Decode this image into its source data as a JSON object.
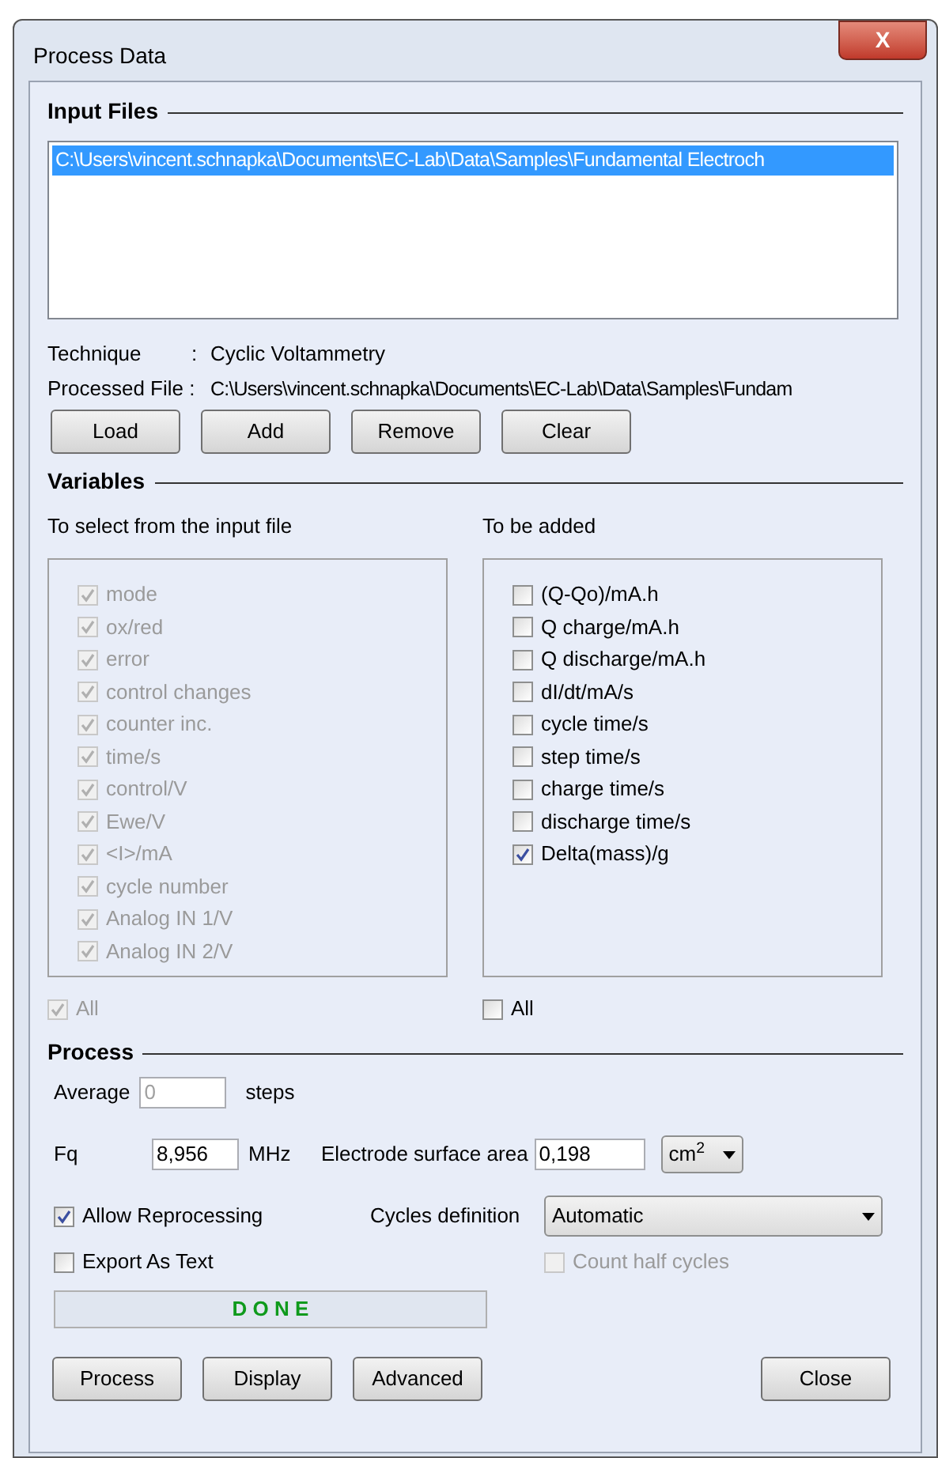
{
  "window": {
    "title": "Process Data",
    "close_label": "X"
  },
  "input_files": {
    "heading": "Input Files",
    "files": [
      {
        "path": "C:\\Users\\vincent.schnapka\\Documents\\EC-Lab\\Data\\Samples\\Fundamental Electroch",
        "selected": true
      }
    ],
    "technique_label": "Technique",
    "technique_sep": ":",
    "technique": "Cyclic Voltammetry",
    "processed_label": "Processed File :",
    "processed": "C:\\Users\\vincent.schnapka\\Documents\\EC-Lab\\Data\\Samples\\Fundam",
    "buttons": [
      "Load",
      "Add",
      "Remove",
      "Clear"
    ]
  },
  "variables": {
    "heading": "Variables",
    "from_file": {
      "title": "To select from the input file",
      "items": [
        {
          "label": "mode",
          "checked": true,
          "disabled": true
        },
        {
          "label": "ox/red",
          "checked": true,
          "disabled": true
        },
        {
          "label": "error",
          "checked": true,
          "disabled": true
        },
        {
          "label": "control changes",
          "checked": true,
          "disabled": true
        },
        {
          "label": "counter inc.",
          "checked": true,
          "disabled": true
        },
        {
          "label": "time/s",
          "checked": true,
          "disabled": true
        },
        {
          "label": "control/V",
          "checked": true,
          "disabled": true
        },
        {
          "label": "Ewe/V",
          "checked": true,
          "disabled": true
        },
        {
          "label": "<I>/mA",
          "checked": true,
          "disabled": true
        },
        {
          "label": "cycle number",
          "checked": true,
          "disabled": true
        },
        {
          "label": "Analog IN 1/V",
          "checked": true,
          "disabled": true
        },
        {
          "label": "Analog IN 2/V",
          "checked": true,
          "disabled": true
        }
      ],
      "all": {
        "label": "All",
        "checked": true,
        "disabled": true
      }
    },
    "to_add": {
      "title": "To be added",
      "items": [
        {
          "label": "(Q-Qo)/mA.h",
          "checked": false,
          "disabled": false
        },
        {
          "label": "Q charge/mA.h",
          "checked": false,
          "disabled": false
        },
        {
          "label": "Q discharge/mA.h",
          "checked": false,
          "disabled": false
        },
        {
          "label": "dI/dt/mA/s",
          "checked": false,
          "disabled": false
        },
        {
          "label": "cycle time/s",
          "checked": false,
          "disabled": false
        },
        {
          "label": "step time/s",
          "checked": false,
          "disabled": false
        },
        {
          "label": "charge time/s",
          "checked": false,
          "disabled": false
        },
        {
          "label": "discharge time/s",
          "checked": false,
          "disabled": false
        },
        {
          "label": "Delta(mass)/g",
          "checked": true,
          "disabled": false
        }
      ],
      "all": {
        "label": "All",
        "checked": false,
        "disabled": false
      }
    }
  },
  "process": {
    "heading": "Process",
    "average": {
      "label": "Average",
      "value": "0",
      "unit": "steps",
      "disabled": true
    },
    "fq": {
      "label": "Fq",
      "value": "8,956",
      "unit": "MHz"
    },
    "area": {
      "label": "Electrode surface area",
      "value": "0,198",
      "unit": "cm$^{2}$"
    },
    "allow_reprocessing": {
      "label": "Allow Reprocessing",
      "checked": true,
      "disabled": false
    },
    "export_as_text": {
      "label": "Export As Text",
      "checked": false,
      "disabled": false
    },
    "cycles_definition": {
      "label": "Cycles definition",
      "value": "Automatic"
    },
    "count_half_cycles": {
      "label": "Count half cycles",
      "checked": false,
      "disabled": true
    },
    "status": "D O N E",
    "buttons": [
      "Process",
      "Display",
      "Advanced"
    ],
    "close_button": "Close"
  }
}
